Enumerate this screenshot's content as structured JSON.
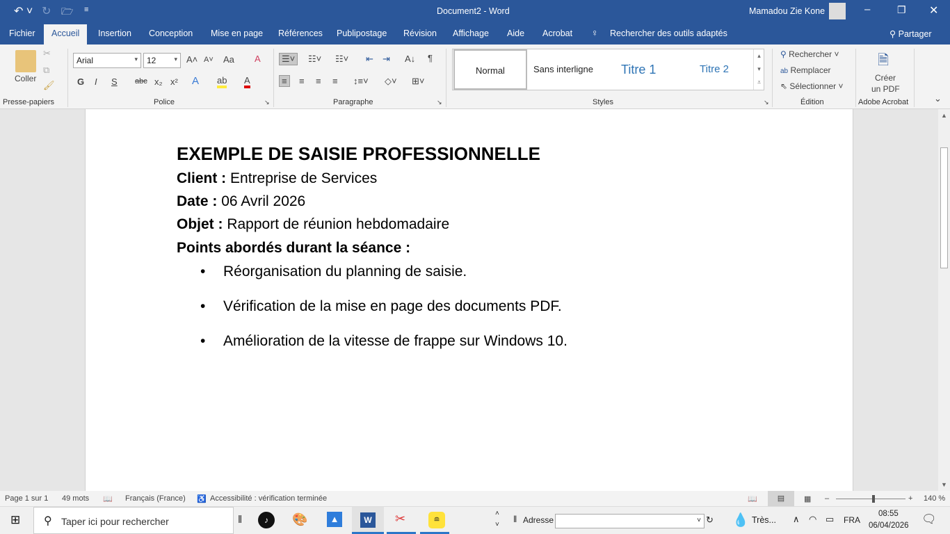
{
  "window": {
    "title": "Document2  -  Word",
    "user": "Mamadou Zie Kone"
  },
  "tabs": [
    "Fichier",
    "Accueil",
    "Insertion",
    "Conception",
    "Mise en page",
    "Références",
    "Publipostage",
    "Révision",
    "Affichage",
    "Aide",
    "Acrobat"
  ],
  "tell_me": "Rechercher des outils adaptés",
  "share": "Partager",
  "ribbon": {
    "clipboard": {
      "paste": "Coller",
      "group": "Presse-papiers"
    },
    "font": {
      "name": "Arial",
      "size": "12",
      "group": "Police",
      "bold": "G",
      "italic": "I",
      "underline": "S",
      "strike": "abc",
      "case": "Aa"
    },
    "paragraph": {
      "group": "Paragraphe"
    },
    "styles": {
      "items": [
        "Normal",
        "Sans interligne",
        "Titre 1",
        "Titre 2"
      ],
      "group": "Styles"
    },
    "editing": {
      "find": "Rechercher",
      "replace": "Remplacer",
      "select": "Sélectionner",
      "group": "Édition"
    },
    "acrobat": {
      "create1": "Créer",
      "create2": "un PDF",
      "group": "Adobe Acrobat"
    }
  },
  "document": {
    "heading": "EXEMPLE DE SAISIE PROFESSIONNELLE",
    "fields": [
      {
        "label": "Client :",
        "value": " Entreprise de Services"
      },
      {
        "label": "Date :",
        "value": " 06 Avril 2026"
      },
      {
        "label": "Objet :",
        "value": " Rapport de réunion hebdomadaire"
      }
    ],
    "points_title": "Points abordés durant la séance :",
    "bullets": [
      "Réorganisation du planning de saisie.",
      "Vérification de la mise en page des documents PDF.",
      "Amélioration de la vitesse de frappe sur Windows 10."
    ]
  },
  "status": {
    "page": "Page 1 sur 1",
    "words": "49 mots",
    "language": "Français (France)",
    "accessibility": "Accessibilité : vérification terminée",
    "zoom": "140 %",
    "zoom_percent": 140
  },
  "taskbar": {
    "search_placeholder": "Taper ici pour rechercher",
    "address_label": "Adresse",
    "weather": "Très...",
    "lang": "FRA",
    "time": "08:55",
    "date": "06/04/2026"
  },
  "colors": {
    "accent": "#2b579a"
  }
}
